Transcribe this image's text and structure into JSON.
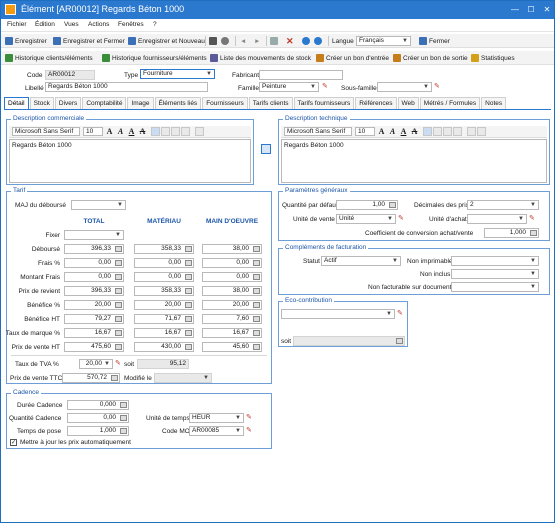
{
  "window": {
    "title": "Élément [AR00012] Regards  Béton 1000",
    "min": "—",
    "max": "☐",
    "close": "✕"
  },
  "menu": [
    "Fichier",
    "Édition",
    "Vues",
    "Actions",
    "Fenêtres",
    "?"
  ],
  "toolbar1": {
    "save": "Enregistrer",
    "save_close": "Enregistrer et Fermer",
    "save_new": "Enregistrer et Nouveau",
    "lang_label": "Langue",
    "lang_value": "Français",
    "close": "Fermer"
  },
  "toolbar2": {
    "hist_clients": "Historique clients/éléments",
    "hist_suppliers": "Historique fournisseurs/éléments",
    "stock_moves": "Liste des mouvements de stock",
    "entry_voucher": "Créer un bon d'entrée",
    "exit_voucher": "Créer un bon de sortie",
    "stats": "Statistiques"
  },
  "header": {
    "code_label": "Code",
    "code_value": "AR00012",
    "type_label": "Type",
    "type_value": "Fourniture",
    "maker_label": "Fabricant",
    "maker_value": "",
    "label_label": "Libellé",
    "label_value": "Regards  Béton 1000",
    "family_label": "Famille",
    "family_value": "Peinture",
    "subfamily_label": "Sous-famille",
    "subfamily_value": ""
  },
  "tabs": [
    "Détail",
    "Stock",
    "Divers",
    "Comptabilité",
    "Image",
    "Éléments liés",
    "Fournisseurs",
    "Tarifs clients",
    "Tarifs fournisseurs",
    "Références",
    "Web",
    "Métrés / Formules",
    "Notes"
  ],
  "desc_com": {
    "title": "Description commerciale",
    "font": "Microsoft Sans Serif",
    "size": "10",
    "text": "Regards  Béton 1000"
  },
  "desc_tech": {
    "title": "Description technique",
    "font": "Microsoft Sans Serif",
    "size": "10",
    "text": "Regards  Béton 1000"
  },
  "tarif": {
    "title": "Tarif",
    "maj_label": "MAJ du déboursé",
    "maj_value": "",
    "col_total": "TOTAL",
    "col_mat": "MATÉRIAU",
    "col_mo": "MAIN D'OEUVRE",
    "rows": [
      {
        "label": "Fixer",
        "total": "",
        "mat": "",
        "mo": ""
      },
      {
        "label": "Déboursé",
        "total": "396,33",
        "mat": "358,33",
        "mo": "38,00"
      },
      {
        "label": "Frais %",
        "total": "0,00",
        "mat": "0,00",
        "mo": "0,00"
      },
      {
        "label": "Montant Frais",
        "total": "0,00",
        "mat": "0,00",
        "mo": "0,00"
      },
      {
        "label": "Prix de revient",
        "total": "396,33",
        "mat": "358,33",
        "mo": "38,00"
      },
      {
        "label": "Bénéfice %",
        "total": "20,00",
        "mat": "20,00",
        "mo": "20,00"
      },
      {
        "label": "Bénéfice HT",
        "total": "79,27",
        "mat": "71,67",
        "mo": "7,60"
      },
      {
        "label": "Taux de marque %",
        "total": "16,67",
        "mat": "16,67",
        "mo": "16,67"
      },
      {
        "label": "Prix de vente HT",
        "total": "475,60",
        "mat": "430,00",
        "mo": "45,60"
      }
    ],
    "tva_label": "Taux de TVA %",
    "tva_value": "20,00",
    "soit_label": "soit",
    "soit_value": "95,12",
    "pvttc_label": "Prix de vente TTC",
    "pvttc_value": "570,72",
    "modif_label": "Modifié le",
    "modif_value": ""
  },
  "params": {
    "title": "Paramètres généraux",
    "qty_label": "Quantité par défaut",
    "qty_value": "1,00",
    "dec_label": "Décimales des prix",
    "dec_value": "2",
    "sale_unit_label": "Unité de vente",
    "sale_unit_value": "Unité",
    "buy_unit_label": "Unité d'achat",
    "buy_unit_value": "",
    "coef_label": "Coefficient de conversion achat/vente",
    "coef_value": "1,000"
  },
  "billing": {
    "title": "Compléments de facturation",
    "status_label": "Statut",
    "status_value": "Actif",
    "nonprint_label": "Non imprimable",
    "nonprint_value": "",
    "noninc_label": "Non inclus",
    "noninc_value": "",
    "nonbill_label": "Non facturable sur documents",
    "nonbill_value": ""
  },
  "eco": {
    "title": "Eco-contribution",
    "value": "",
    "soit_label": "soit",
    "soit_value": ""
  },
  "cadence": {
    "title": "Cadence",
    "duree_label": "Durée Cadence",
    "duree_value": "0,000",
    "qty_label": "Quantité Cadence",
    "qty_value": "0,00",
    "pose_label": "Temps de pose",
    "pose_value": "1,000",
    "unit_label": "Unité de temps",
    "unit_value": "HEUR",
    "codemo_label": "Code MO",
    "codemo_value": "AR00085",
    "auto_label": "Mettre à jour les prix automatiquement"
  },
  "colors": {
    "title_bar": "#2b78cf",
    "group_border": "#6d9ed6",
    "group_title": "#1c56a8"
  }
}
